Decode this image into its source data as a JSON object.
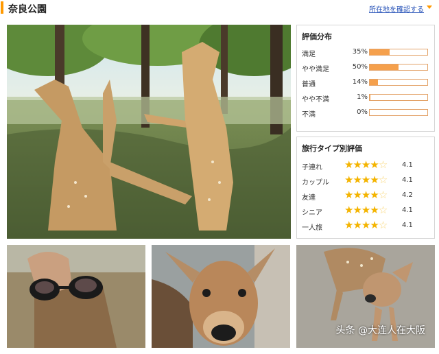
{
  "header": {
    "title": "奈良公園",
    "location_link": "所在地を確認する",
    "accent_color": "#ff9900",
    "link_color": "#2a55b9"
  },
  "rating_distribution": {
    "title": "評価分布",
    "bar_color": "#f5a04c",
    "rows": [
      {
        "label": "満足",
        "percent": "35%",
        "fraction": 0.35
      },
      {
        "label": "やや満足",
        "percent": "50%",
        "fraction": 0.5
      },
      {
        "label": "普通",
        "percent": "14%",
        "fraction": 0.14
      },
      {
        "label": "やや不満",
        "percent": "1%",
        "fraction": 0.01
      },
      {
        "label": "不満",
        "percent": "0%",
        "fraction": 0.0
      }
    ]
  },
  "travel_type": {
    "title": "旅行タイプ別評価",
    "star_color": "#f4b400",
    "rows": [
      {
        "label": "子連れ",
        "score": "4.1",
        "stars": 4.1
      },
      {
        "label": "カップル",
        "score": "4.1",
        "stars": 4.1
      },
      {
        "label": "友達",
        "score": "4.2",
        "stars": 4.2
      },
      {
        "label": "シニア",
        "score": "4.1",
        "stars": 4.1
      },
      {
        "label": "一人旅",
        "score": "4.1",
        "stars": 4.1
      }
    ]
  },
  "photos": {
    "main": "deer-standing-photo",
    "thumbnails": [
      "deer-sunglasses-photo",
      "deer-closeup-photo",
      "fawn-photo"
    ]
  },
  "watermark": "头条 @大连人在大阪"
}
